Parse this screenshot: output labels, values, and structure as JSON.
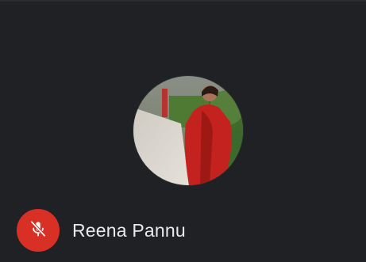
{
  "participant": {
    "name": "Reena Pannu",
    "mic_state_icon": "mic-off-icon",
    "avatar": "participant-photo"
  },
  "colors": {
    "background": "#202124",
    "mic_muted": "#d93025",
    "name_text": "#e8eaed"
  }
}
